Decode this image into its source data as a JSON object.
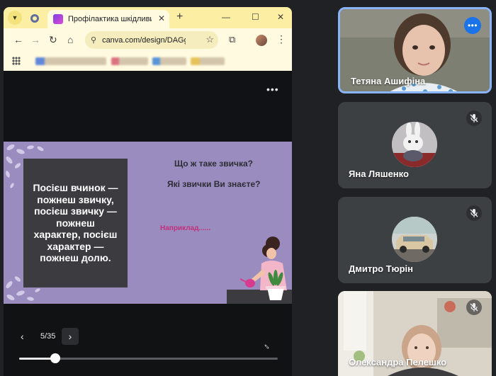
{
  "browser": {
    "tab_title": "Профілактика шкідливих звичок",
    "url": "canva.com/design/DAGg...",
    "icons": {
      "tab_menu": "chevron-down-icon",
      "close": "close-icon",
      "new_tab": "plus-icon",
      "back": "arrow-left-icon",
      "forward": "arrow-right-icon",
      "reload": "reload-icon",
      "home": "home-icon",
      "star": "star-icon",
      "extensions": "puzzle-icon",
      "more": "kebab-icon"
    },
    "glyphs": {
      "tab_menu": "▼",
      "close": "✕",
      "new_tab": "+",
      "minimize": "—",
      "maximize": "☐",
      "win_close": "✕",
      "back": "←",
      "forward": "→",
      "reload": "↻",
      "home": "⌂",
      "tune": "⚲",
      "star": "☆",
      "extensions": "⧉",
      "kebab": "⋮"
    }
  },
  "viewer": {
    "menu_glyph": "•••",
    "prev_glyph": "‹",
    "next_glyph": "›",
    "fullscreen_glyph": "⇔",
    "page_indicator": "5/35",
    "progress": 0.14,
    "colors": {
      "slide_bg": "#9b8cbf",
      "quote_box": "#3b3b40",
      "example_text": "#c0307c"
    }
  },
  "slide": {
    "quote_lines": [
      "Посієш вчинок —",
      "пожнеш звичку,",
      "посієш звичку —",
      "пожнеш",
      "характер, посієш",
      "характер —",
      "пожнеш долю."
    ],
    "question1": "Що ж таке звичка?",
    "question2": "Які звички Ви знаєте?",
    "example": "Наприклад......"
  },
  "participants": [
    {
      "name": "Тетяна Ашифіна",
      "speaking": true,
      "options_glyph": "•••"
    },
    {
      "name": "Яна Ляшенко",
      "muted": true
    },
    {
      "name": "Дмитро Тюрін",
      "muted": true
    },
    {
      "name": "Олександра Пелешко",
      "muted": true
    }
  ],
  "accent": "#8ab4f8"
}
